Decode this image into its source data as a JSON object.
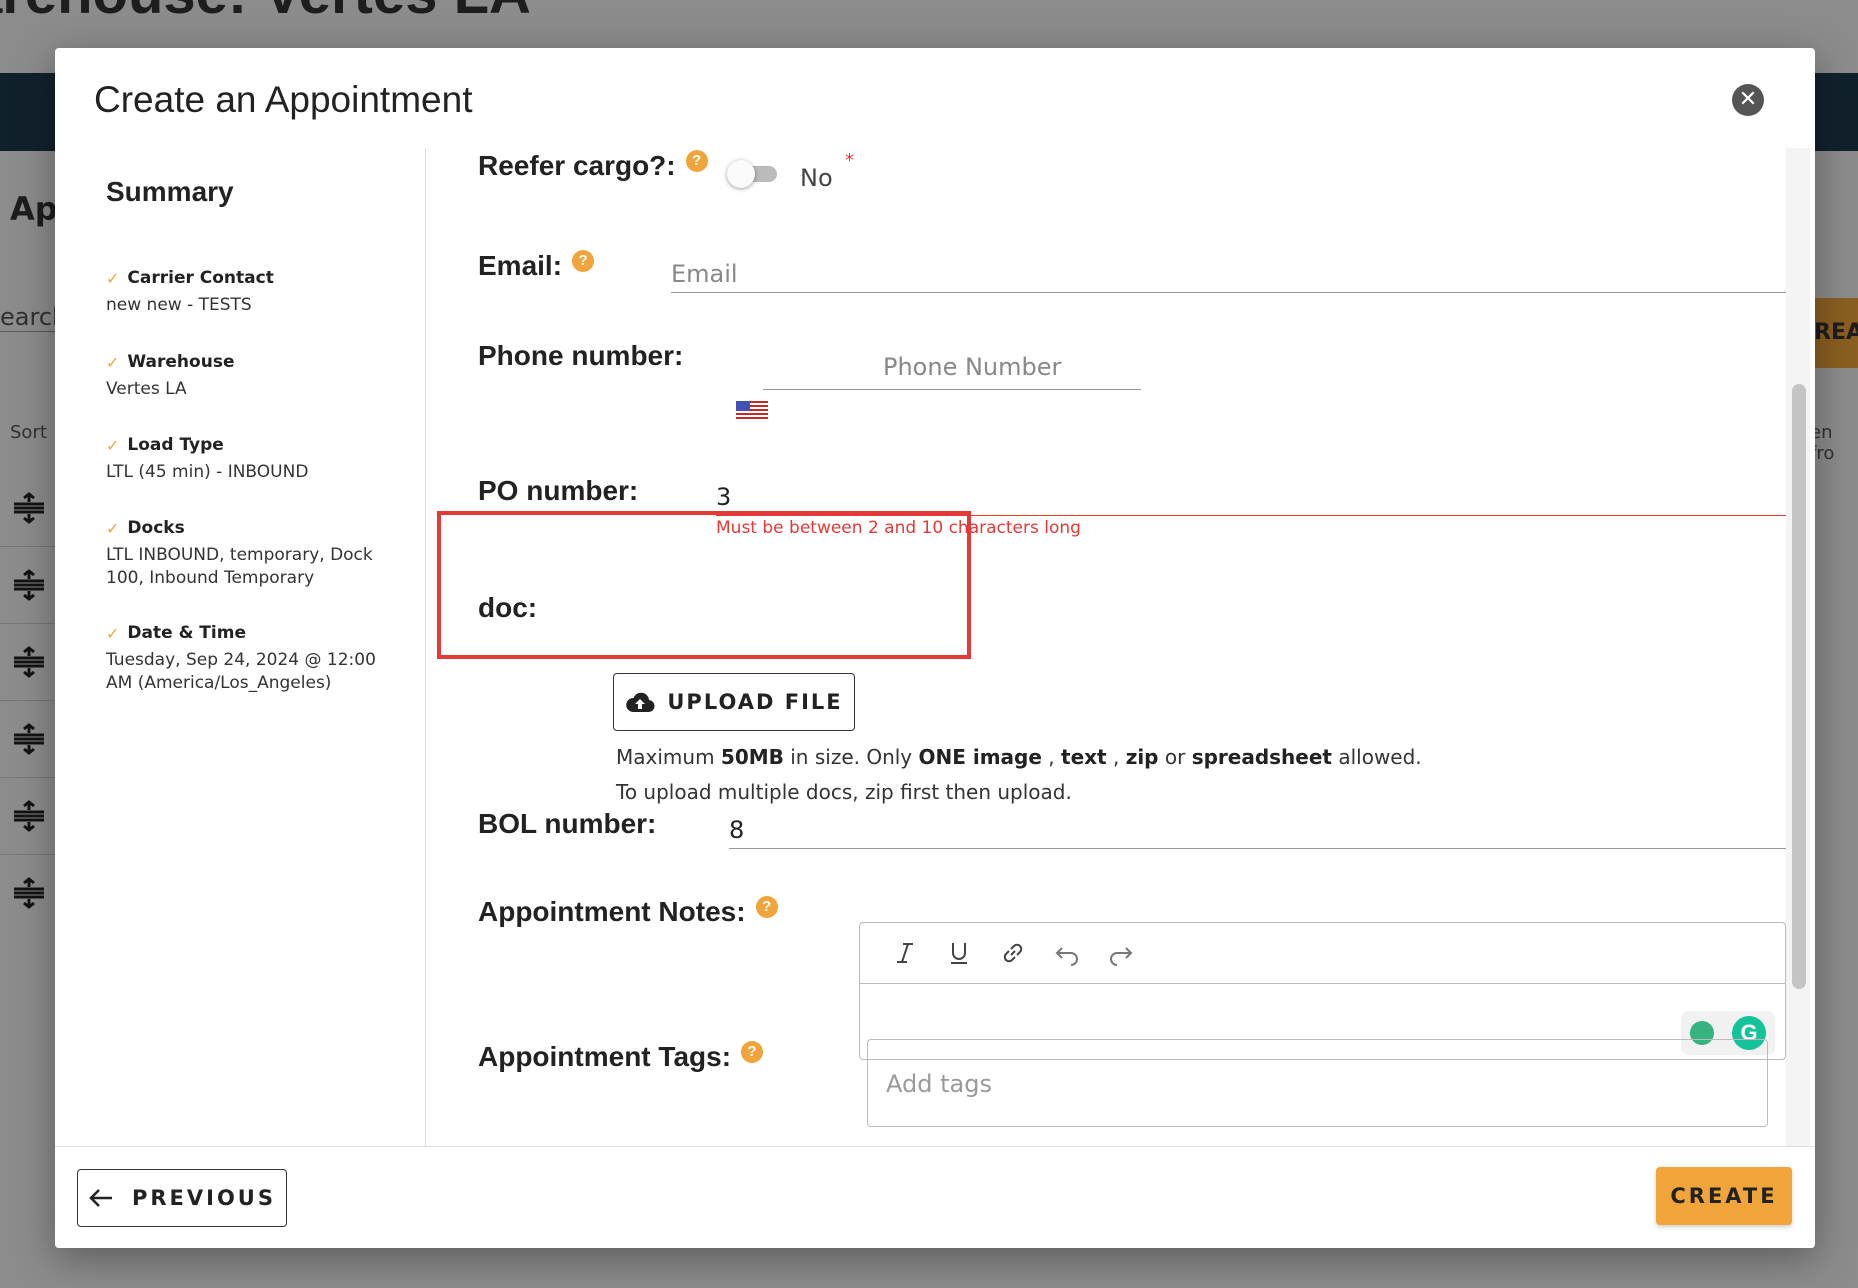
{
  "background": {
    "page_title": "arehouse: Vertes LA",
    "heading": "Ap",
    "search_text": "earch",
    "sort_label": "Sort",
    "orange_button_label": "REA",
    "right_text": "en fro"
  },
  "modal": {
    "title": "Create an Appointment",
    "close_icon": "close-icon"
  },
  "summary": {
    "heading": "Summary",
    "items": [
      {
        "label": "Carrier Contact",
        "value": "new new - TESTS"
      },
      {
        "label": "Warehouse",
        "value": "Vertes LA"
      },
      {
        "label": "Load Type",
        "value": "LTL (45 min) - INBOUND"
      },
      {
        "label": "Docks",
        "value": "LTL INBOUND, temporary, Dock 100, Inbound Temporary"
      },
      {
        "label": "Date & Time",
        "value": "Tuesday, Sep 24, 2024 @ 12:00 AM (America/Los_Angeles)"
      }
    ]
  },
  "form": {
    "reefer": {
      "label": "Reefer cargo?:",
      "toggle_text": "No",
      "required_mark": "*",
      "help": "?"
    },
    "email": {
      "label": "Email:",
      "placeholder": "Email",
      "help": "?"
    },
    "phone": {
      "label": "Phone number:",
      "placeholder": "Phone Number",
      "flag_icon": "us-flag-icon"
    },
    "po": {
      "label": "PO number:",
      "value": "3",
      "error": "Must be between 2 and 10 characters long"
    },
    "doc": {
      "label": "doc:",
      "upload_label": "UPLOAD FILE",
      "info_line1_parts": [
        "Maximum ",
        "50MB",
        " in size. Only ",
        "ONE image",
        " , ",
        "text",
        " , ",
        "zip",
        " or ",
        "spreadsheet",
        " allowed."
      ],
      "info_line2": "To upload multiple docs, zip first then upload."
    },
    "bol": {
      "label": "BOL number:",
      "value": "8"
    },
    "notes": {
      "label": "Appointment Notes:",
      "help": "?",
      "toolbar": [
        "italic-icon",
        "underline-icon",
        "link-icon",
        "undo-icon",
        "redo-icon"
      ]
    },
    "tags": {
      "label": "Appointment Tags:",
      "placeholder": "Add tags",
      "help": "?"
    }
  },
  "footer": {
    "previous_label": "PREVIOUS",
    "create_label": "CREATE"
  },
  "colors": {
    "accent": "#f0a43a",
    "error": "#e53935",
    "navbar": "#1e3a4c"
  }
}
